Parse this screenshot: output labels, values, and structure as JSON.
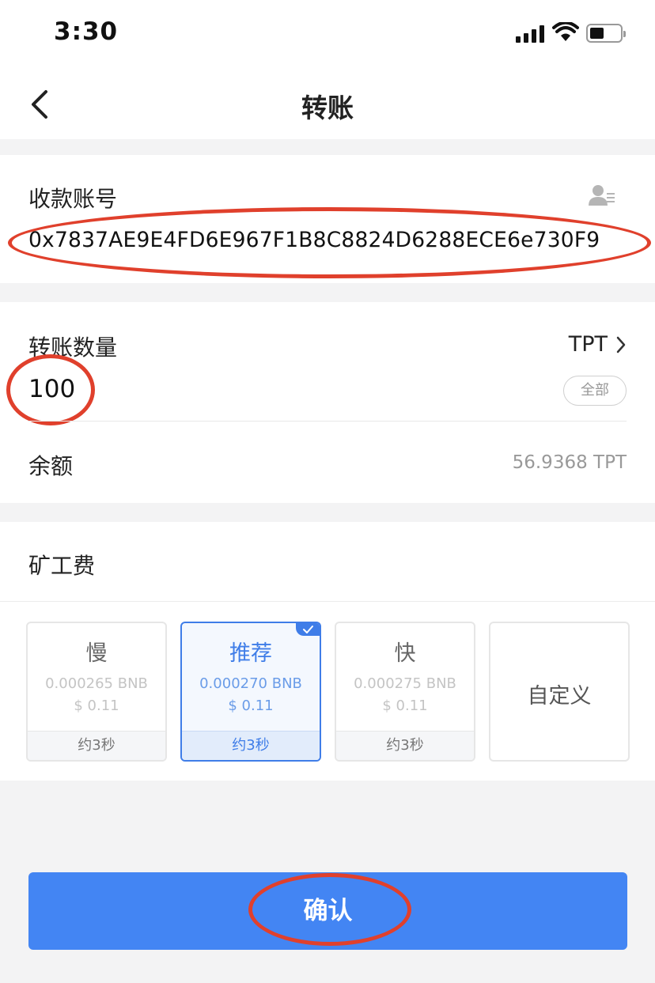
{
  "status_bar": {
    "time": "3:30"
  },
  "nav": {
    "title": "转账"
  },
  "recipient": {
    "label": "收款账号",
    "address": "0x7837AE9E4FD6E967F1B8C8824D6288ECE6e730F9"
  },
  "amount": {
    "label": "转账数量",
    "token": "TPT",
    "value": "100",
    "all_button": "全部",
    "balance_label": "余额",
    "balance_value": "56.9368 TPT"
  },
  "fee": {
    "label": "矿工费",
    "options": [
      {
        "name": "慢",
        "amount": "0.000265 BNB",
        "usd": "$ 0.11",
        "time": "约3秒",
        "selected": false
      },
      {
        "name": "推荐",
        "amount": "0.000270 BNB",
        "usd": "$ 0.11",
        "time": "约3秒",
        "selected": true
      },
      {
        "name": "快",
        "amount": "0.000275 BNB",
        "usd": "$ 0.11",
        "time": "约3秒",
        "selected": false
      }
    ],
    "custom_label": "自定义"
  },
  "confirm_button": "确认",
  "colors": {
    "accent": "#4385f3",
    "highlight": "#e0402c"
  },
  "icons": [
    "back-chevron-icon",
    "contact-book-icon",
    "chevron-right-icon",
    "check-icon",
    "signal-icon",
    "wifi-icon",
    "battery-icon"
  ]
}
